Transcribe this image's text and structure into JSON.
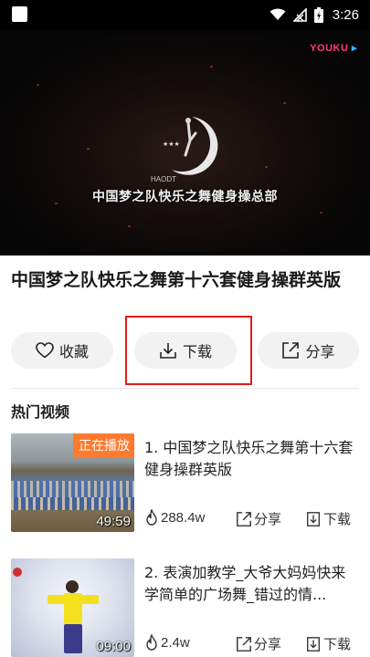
{
  "status_bar": {
    "time": "3:26"
  },
  "video": {
    "watermark": "YOUKU",
    "logo_text": "HAODT",
    "caption": "中国梦之队快乐之舞健身操总部"
  },
  "title": "中国梦之队快乐之舞第十六套健身操群英版",
  "actions": {
    "favorite_label": "收藏",
    "download_label": "下载",
    "share_label": "分享"
  },
  "section_title": "热门视频",
  "videos": [
    {
      "title": "1. 中国梦之队快乐之舞第十六套健身操群英版",
      "badge": "正在播放",
      "duration": "49:59",
      "views": "288.4w",
      "share_label": "分享",
      "download_label": "下载"
    },
    {
      "title": "2. 表演加教学_大爷大妈妈快来学简单的广场舞_错过的情...",
      "duration": "09:00",
      "views": "2.4w",
      "share_label": "分享",
      "download_label": "下载"
    }
  ],
  "colors": {
    "highlight": "#e21b1b",
    "badge": "#ff7a2f",
    "button_bg": "#f2f2f2"
  }
}
